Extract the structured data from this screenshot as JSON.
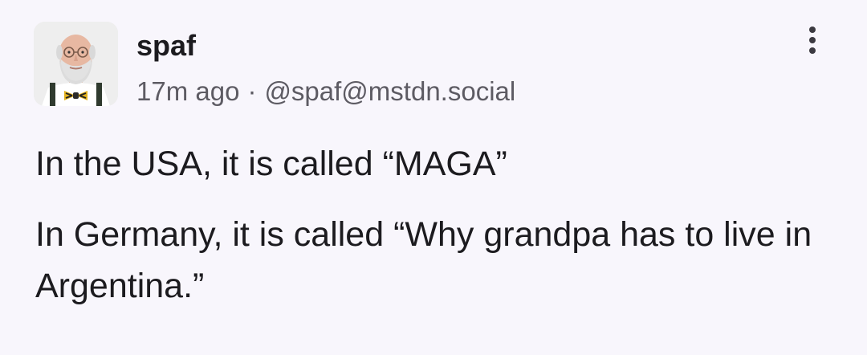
{
  "post": {
    "author": {
      "display_name": "spaf",
      "avatar_icon": "avatar-photo-icon"
    },
    "time_ago": "17m ago",
    "separator": "·",
    "handle": "@spaf@mstdn.social",
    "more_icon": "more-vertical-icon",
    "paragraphs": [
      "In the USA, it is called “MAGA”",
      "In Germany, it is called “Why grandpa has to live in Argentina.”"
    ]
  }
}
